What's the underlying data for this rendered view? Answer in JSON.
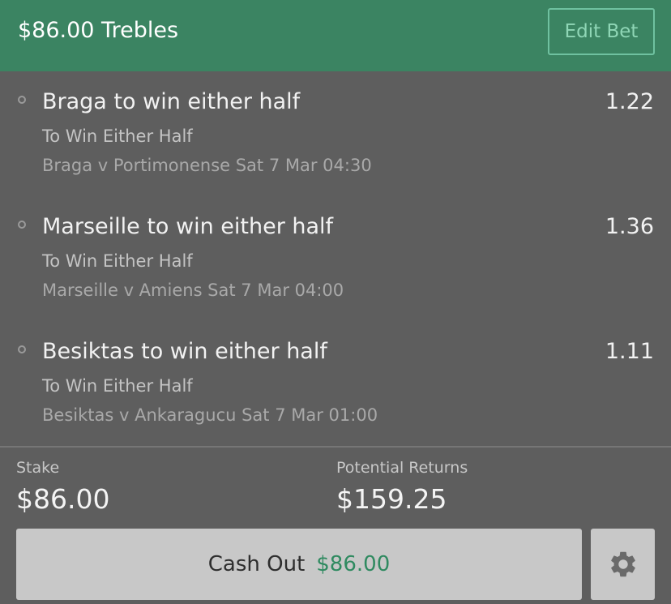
{
  "header": {
    "title": "$86.00 Trebles",
    "edit_label": "Edit Bet"
  },
  "selections": [
    {
      "title": "Braga to win either half",
      "odds": "1.22",
      "market": "To Win Either Half",
      "event": "Braga v Portimonense Sat 7 Mar 04:30"
    },
    {
      "title": "Marseille to win either half",
      "odds": "1.36",
      "market": "To Win Either Half",
      "event": "Marseille v Amiens Sat 7 Mar 04:00"
    },
    {
      "title": "Besiktas to win either half",
      "odds": "1.11",
      "market": "To Win Either Half",
      "event": "Besiktas v Ankaragucu Sat 7 Mar 01:00"
    }
  ],
  "summary": {
    "stake_label": "Stake",
    "stake_value": "$86.00",
    "returns_label": "Potential Returns",
    "returns_value": "$159.25"
  },
  "actions": {
    "cashout_label": "Cash Out",
    "cashout_amount": "$86.00",
    "settings_icon": "gear-icon"
  },
  "colors": {
    "header_bg": "#3b8462",
    "body_bg": "#5e5e5e",
    "accent_green": "#2f8a60",
    "button_bg": "#c8c8c8"
  }
}
